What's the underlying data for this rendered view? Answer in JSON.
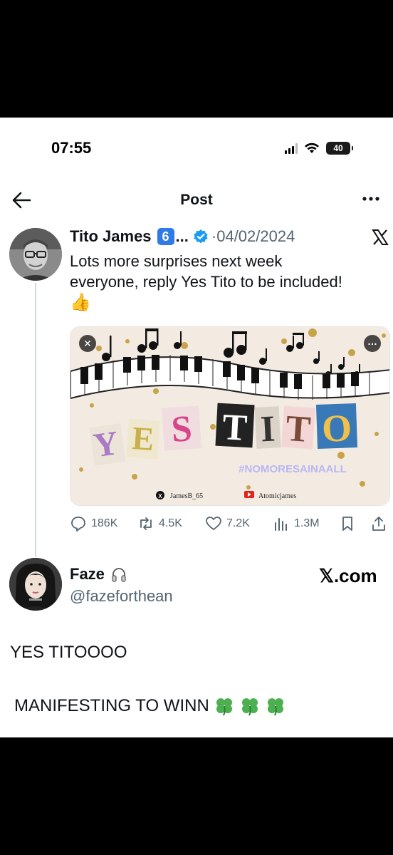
{
  "status_bar": {
    "time": "07:55",
    "battery": "40"
  },
  "header": {
    "title": "Post"
  },
  "tweet": {
    "author": "Tito James",
    "badge": "6",
    "truncation": "...",
    "date": "·04/02/2024",
    "text_line1": "Lots more surprises next week",
    "text_line2": "everyone, reply Yes Tito to be included!",
    "emoji": "👍",
    "media": {
      "title": "YES TITO",
      "hashtag": "#NOMORESAINAALL",
      "x_handle": "JamesB_65",
      "yt_channel": "Atomicjames"
    },
    "stats": {
      "replies": "186K",
      "reposts": "4.5K",
      "likes": "7.2K",
      "views": "1.3M"
    }
  },
  "reply": {
    "name": "Faze",
    "handle": "@fazeforthean",
    "source": "𝕏.com",
    "line1": "YES TITOOOO",
    "line2": "MANIFESTING TO WINN"
  },
  "colors": {
    "verified": "#1d9bf0",
    "secondary_text": "#536471",
    "clover": "#4caf50"
  }
}
